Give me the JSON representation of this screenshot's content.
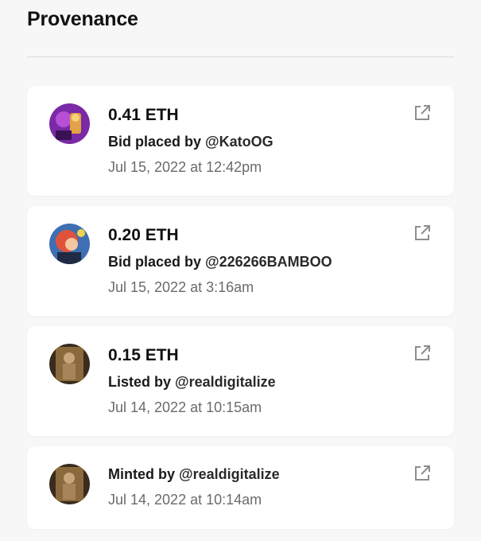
{
  "header": {
    "title": "Provenance"
  },
  "events": [
    {
      "price": "0.41 ETH",
      "action": "Bid placed by",
      "user": "@KatoOG",
      "date": "Jul 15, 2022 at 12:42pm",
      "avatar_colors": [
        "#8b2fb3",
        "#e2a13b"
      ]
    },
    {
      "price": "0.20 ETH",
      "action": "Bid placed by",
      "user": "@226266BAMBOO",
      "date": "Jul 15, 2022 at 3:16am",
      "avatar_colors": [
        "#e0533a",
        "#3d6fb2"
      ]
    },
    {
      "price": "0.15 ETH",
      "action": "Listed by",
      "user": "@realdigitalize",
      "date": "Jul 14, 2022 at 10:15am",
      "avatar_colors": [
        "#8a6a3c",
        "#3b2b1e"
      ]
    },
    {
      "price": "",
      "action": "Minted by",
      "user": "@realdigitalize",
      "date": "Jul 14, 2022 at 10:14am",
      "avatar_colors": [
        "#8a6a3c",
        "#3b2b1e"
      ]
    }
  ],
  "icons": {
    "external": "external-link-icon"
  }
}
